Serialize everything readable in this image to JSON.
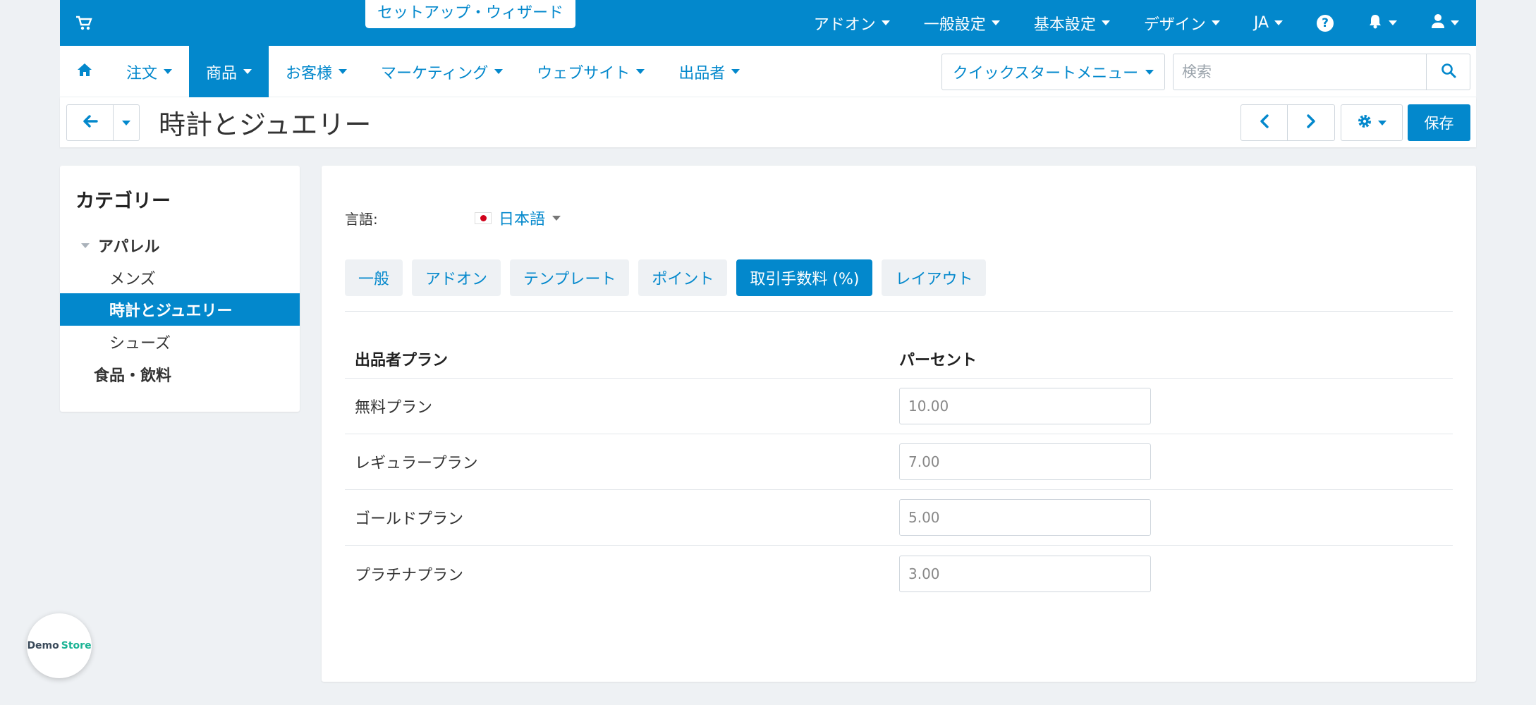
{
  "topbar": {
    "setup_wizard": "セットアップ・ウィザード",
    "items": [
      {
        "label": "アドオン"
      },
      {
        "label": "一般設定"
      },
      {
        "label": "基本設定"
      },
      {
        "label": "デザイン"
      },
      {
        "label": "JA"
      }
    ]
  },
  "nav": {
    "items": [
      {
        "label": "注文"
      },
      {
        "label": "商品"
      },
      {
        "label": "お客様"
      },
      {
        "label": "マーケティング"
      },
      {
        "label": "ウェブサイト"
      },
      {
        "label": "出品者"
      }
    ],
    "quickstart": "クイックスタートメニュー",
    "search_placeholder": "検索"
  },
  "page": {
    "title": "時計とジュエリー",
    "save": "保存"
  },
  "sidebar": {
    "title": "カテゴリー",
    "items": [
      {
        "label": "アパレル"
      },
      {
        "label": "メンズ"
      },
      {
        "label": "時計とジュエリー"
      },
      {
        "label": "シューズ"
      },
      {
        "label": "食品・飲料"
      }
    ]
  },
  "main": {
    "language_label": "言語:",
    "language_value": "日本語",
    "tabs": [
      {
        "label": "一般"
      },
      {
        "label": "アドオン"
      },
      {
        "label": "テンプレート"
      },
      {
        "label": "ポイント"
      },
      {
        "label": "取引手数料 (%)"
      },
      {
        "label": "レイアウト"
      }
    ],
    "table": {
      "headers": [
        "出品者プラン",
        "パーセント"
      ],
      "rows": [
        {
          "plan": "無料プラン",
          "percent": "10.00"
        },
        {
          "plan": "レギュラープラン",
          "percent": "7.00"
        },
        {
          "plan": "ゴールドプラン",
          "percent": "5.00"
        },
        {
          "plan": "プラチナプラン",
          "percent": "3.00"
        }
      ]
    }
  },
  "badge": {
    "part1": "Demo",
    "part2": "Store"
  },
  "colors": {
    "primary": "#0388cc",
    "background": "#eef1f4",
    "badge_green": "#1ab394"
  }
}
